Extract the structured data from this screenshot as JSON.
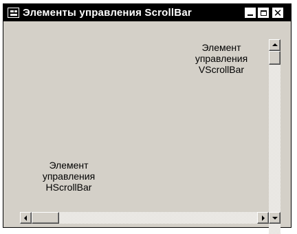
{
  "window": {
    "title": "Элементы управления ScrollBar",
    "buttons": {
      "minimize": "minimize-icon",
      "maximize": "maximize-icon",
      "close": "close-icon"
    }
  },
  "labels": {
    "vscroll": [
      "Элемент",
      "управления",
      "VScrollBar"
    ],
    "hscroll": [
      "Элемент",
      "управления",
      "HScrollBar"
    ]
  },
  "scrollbars": {
    "vertical": {
      "position": 0,
      "icons": [
        "arrow-up-icon",
        "arrow-down-icon"
      ]
    },
    "horizontal": {
      "position": 0,
      "icons": [
        "arrow-left-icon",
        "arrow-right-icon"
      ]
    }
  }
}
